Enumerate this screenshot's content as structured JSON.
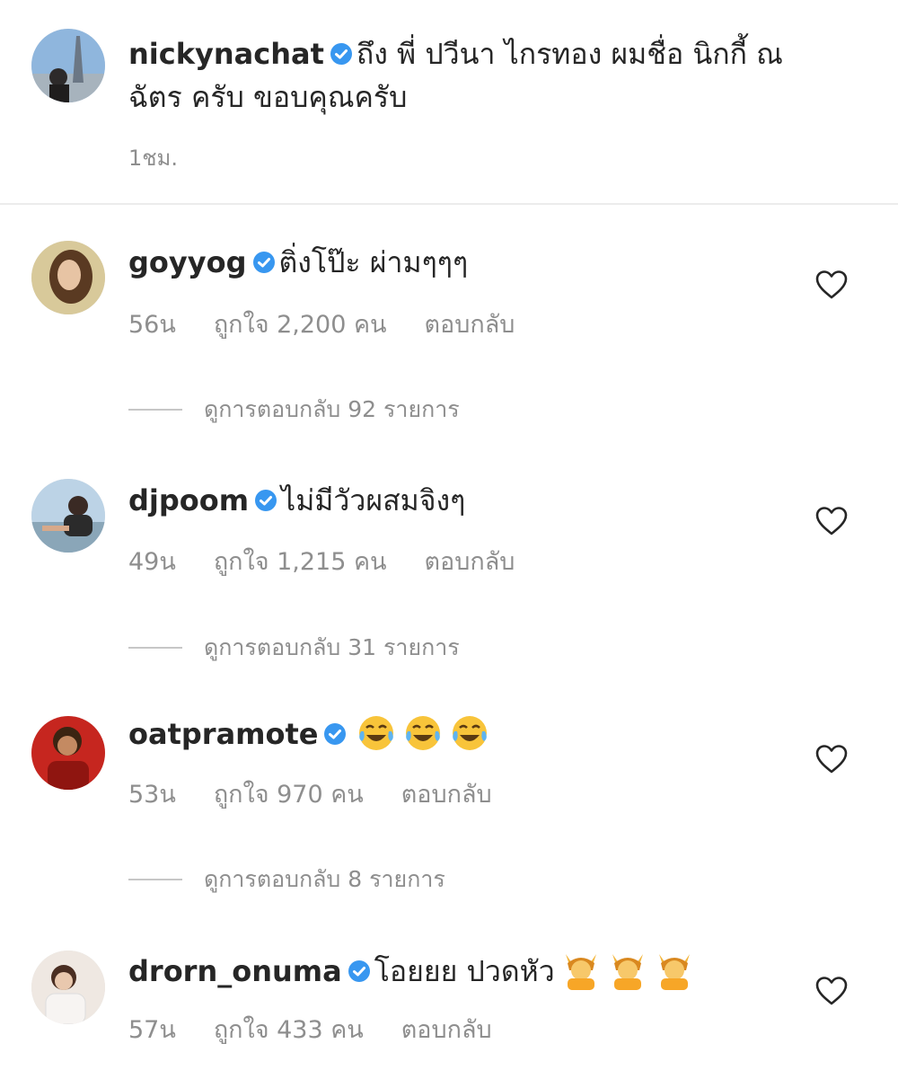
{
  "caption": {
    "username": "nickynachat",
    "text_line1": "ถึง พี่ ปวีนา ไกรทอง ผมชื่อ นิกกี้ ณ",
    "text_line2": "ฉัตร ครับ ขอบคุณครับ",
    "time": "1ชม.",
    "avatar_icon": "eiffel-tower-photo",
    "verified_icon": "verified-badge-icon"
  },
  "comments": [
    {
      "username": "goyyog",
      "text": "ติ่งโป๊ะ ผ่ามๆๆๆ",
      "time": "56น",
      "likes": "ถูกใจ 2,200 คน",
      "reply_label": "ตอบกลับ",
      "view_replies": "ดูการตอบกลับ 92 รายการ",
      "emoji": ""
    },
    {
      "username": "djpoom",
      "text": "ไม่มีวัวผสมจิงๆ",
      "time": "49น",
      "likes": "ถูกใจ 1,215 คน",
      "reply_label": "ตอบกลับ",
      "view_replies": "ดูการตอบกลับ 31 รายการ",
      "emoji": ""
    },
    {
      "username": "oatpramote",
      "text": "",
      "time": "53น",
      "likes": "ถูกใจ 970 คน",
      "reply_label": "ตอบกลับ",
      "view_replies": "ดูการตอบกลับ 8 รายการ",
      "emoji": "face-with-tears-of-joy x3"
    },
    {
      "username": "drorn_onuma",
      "text": "โอยยย ปวดหัว",
      "time": "57น",
      "likes": "ถูกใจ 433 คน",
      "reply_label": "ตอบกลับ",
      "view_replies": "",
      "emoji": "person-gesturing-ok x3"
    }
  ],
  "colors": {
    "verified": "#3897f0",
    "text": "#262626",
    "secondary": "#8e8e8e"
  },
  "icons": {
    "like": "heart-outline-icon",
    "verified": "verified-badge-icon"
  }
}
